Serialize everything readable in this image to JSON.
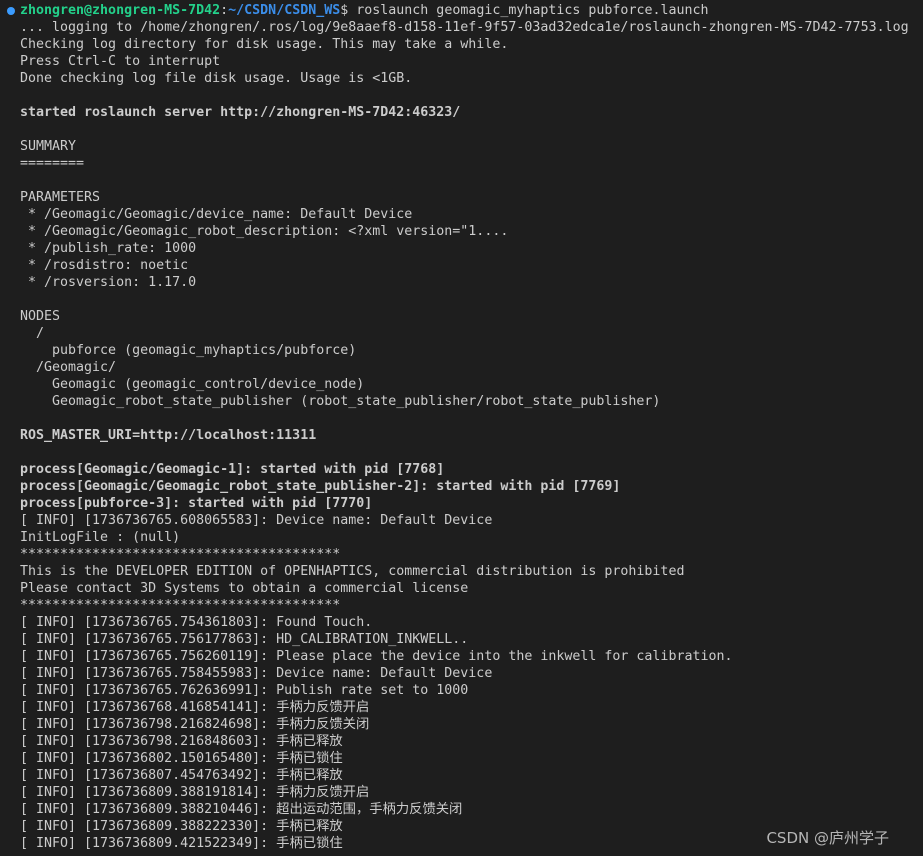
{
  "prompt": {
    "user_host": "zhongren@zhongren-MS-7D42",
    "separator": ":",
    "path": "~/CSDN/CSDN_WS",
    "symbol": "$",
    "command": " roslaunch geomagic_myhaptics pubforce.launch"
  },
  "lines": [
    {
      "text": "... logging to /home/zhongren/.ros/log/9e8aaef8-d158-11ef-9f57-03ad32edca1e/roslaunch-zhongren-MS-7D42-7753.log",
      "bold": false
    },
    {
      "text": "Checking log directory for disk usage. This may take a while.",
      "bold": false
    },
    {
      "text": "Press Ctrl-C to interrupt",
      "bold": false
    },
    {
      "text": "Done checking log file disk usage. Usage is <1GB.",
      "bold": false
    },
    {
      "text": "",
      "bold": false
    },
    {
      "text": "started roslaunch server http://zhongren-MS-7D42:46323/",
      "bold": true
    },
    {
      "text": "",
      "bold": false
    },
    {
      "text": "SUMMARY",
      "bold": false
    },
    {
      "text": "========",
      "bold": false
    },
    {
      "text": "",
      "bold": false
    },
    {
      "text": "PARAMETERS",
      "bold": false
    },
    {
      "text": " * /Geomagic/Geomagic/device_name: Default Device",
      "bold": false
    },
    {
      "text": " * /Geomagic/Geomagic_robot_description: <?xml version=\"1....",
      "bold": false
    },
    {
      "text": " * /publish_rate: 1000",
      "bold": false
    },
    {
      "text": " * /rosdistro: noetic",
      "bold": false
    },
    {
      "text": " * /rosversion: 1.17.0",
      "bold": false
    },
    {
      "text": "",
      "bold": false
    },
    {
      "text": "NODES",
      "bold": false
    },
    {
      "text": "  /",
      "bold": false
    },
    {
      "text": "    pubforce (geomagic_myhaptics/pubforce)",
      "bold": false
    },
    {
      "text": "  /Geomagic/",
      "bold": false
    },
    {
      "text": "    Geomagic (geomagic_control/device_node)",
      "bold": false
    },
    {
      "text": "    Geomagic_robot_state_publisher (robot_state_publisher/robot_state_publisher)",
      "bold": false
    },
    {
      "text": "",
      "bold": false
    },
    {
      "text": "ROS_MASTER_URI=http://localhost:11311",
      "bold": true
    },
    {
      "text": "",
      "bold": false
    },
    {
      "text": "process[Geomagic/Geomagic-1]: started with pid [7768]",
      "bold": true
    },
    {
      "text": "process[Geomagic/Geomagic_robot_state_publisher-2]: started with pid [7769]",
      "bold": true
    },
    {
      "text": "process[pubforce-3]: started with pid [7770]",
      "bold": true
    },
    {
      "text": "[ INFO] [1736736765.608065583]: Device name: Default Device",
      "bold": false
    },
    {
      "text": "InitLogFile : (null)",
      "bold": false
    },
    {
      "text": "****************************************",
      "bold": false
    },
    {
      "text": "This is the DEVELOPER EDITION of OPENHAPTICS, commercial distribution is prohibited",
      "bold": false
    },
    {
      "text": "Please contact 3D Systems to obtain a commercial license",
      "bold": false
    },
    {
      "text": "****************************************",
      "bold": false
    },
    {
      "text": "[ INFO] [1736736765.754361803]: Found Touch.",
      "bold": false
    },
    {
      "text": "[ INFO] [1736736765.756177863]: HD_CALIBRATION_INKWELL..",
      "bold": false
    },
    {
      "text": "[ INFO] [1736736765.756260119]: Please place the device into the inkwell for calibration.",
      "bold": false
    },
    {
      "text": "[ INFO] [1736736765.758455983]: Device name: Default Device",
      "bold": false
    },
    {
      "text": "[ INFO] [1736736765.762636991]: Publish rate set to 1000",
      "bold": false
    },
    {
      "text": "[ INFO] [1736736768.416854141]: 手柄力反馈开启",
      "bold": false
    },
    {
      "text": "[ INFO] [1736736798.216824698]: 手柄力反馈关闭",
      "bold": false
    },
    {
      "text": "[ INFO] [1736736798.216848603]: 手柄已释放",
      "bold": false
    },
    {
      "text": "[ INFO] [1736736802.150165480]: 手柄已锁住",
      "bold": false
    },
    {
      "text": "[ INFO] [1736736807.454763492]: 手柄已释放",
      "bold": false
    },
    {
      "text": "[ INFO] [1736736809.388191814]: 手柄力反馈开启",
      "bold": false
    },
    {
      "text": "[ INFO] [1736736809.388210446]: 超出运动范围，手柄力反馈关闭",
      "bold": false
    },
    {
      "text": "[ INFO] [1736736809.388222330]: 手柄已释放",
      "bold": false
    },
    {
      "text": "[ INFO] [1736736809.421522349]: 手柄已锁住",
      "bold": false
    }
  ],
  "watermark": "CSDN @庐州学子",
  "colors": {
    "background": "#1e1e1e",
    "text": "#cccccc",
    "user_host": "#23d18b",
    "path": "#3b8eea",
    "prompt_dot": "#3b9cff"
  }
}
